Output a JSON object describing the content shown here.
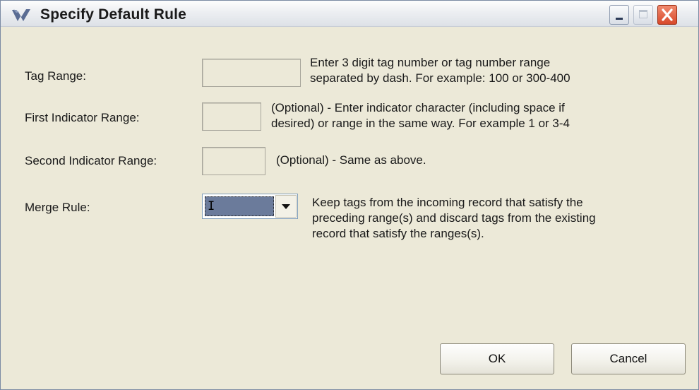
{
  "window": {
    "title": "Specify Default Rule",
    "icon": "app-logo-icon",
    "controls": {
      "minimize": "minimize-icon",
      "maximize": "maximize-icon",
      "close": "close-icon"
    },
    "colors": {
      "close_button": "#d8482a",
      "dialog_bg": "#ece9d8"
    }
  },
  "fields": {
    "tag_range": {
      "label": "Tag Range:",
      "value": "",
      "help_line1": "Enter 3 digit tag number or tag number range",
      "help_line2": "separated by dash.  For example: 100  or 300-400"
    },
    "first_indicator": {
      "label": "First Indicator Range:",
      "value": "",
      "help_line1": "(Optional) - Enter indicator character (including space if",
      "help_line2": "desired) or range in the same way.  For example 1 or 3-4"
    },
    "second_indicator": {
      "label": "Second Indicator Range:",
      "value": "",
      "help_line1": "(Optional) - Same as above."
    },
    "merge_rule": {
      "label": "Merge Rule:",
      "selected": "I",
      "help_line1": "Keep tags from the incoming record that satisfy the",
      "help_line2": "preceding range(s) and discard tags from the existing",
      "help_line3": "record that satisfy the ranges(s)."
    }
  },
  "buttons": {
    "ok": "OK",
    "cancel": "Cancel"
  }
}
